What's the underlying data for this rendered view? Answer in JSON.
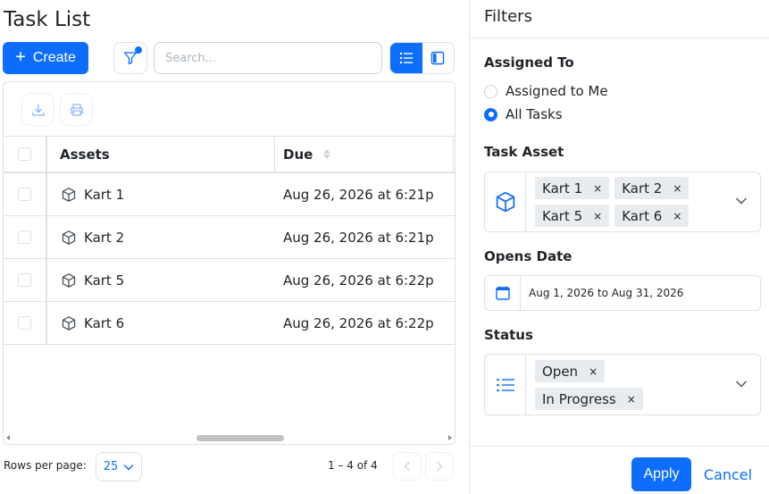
{
  "page": {
    "title": "Task List"
  },
  "toolbar": {
    "create_label": "Create",
    "search_placeholder": "Search..."
  },
  "table": {
    "columns": [
      "Assets",
      "Due"
    ],
    "rows": [
      {
        "asset": "Kart 1",
        "due": "Aug 26, 2026 at 6:21p"
      },
      {
        "asset": "Kart 2",
        "due": "Aug 26, 2026 at 6:21p"
      },
      {
        "asset": "Kart 5",
        "due": "Aug 26, 2026 at 6:22p"
      },
      {
        "asset": "Kart 6",
        "due": "Aug 26, 2026 at 6:22p"
      }
    ]
  },
  "pagination": {
    "rows_per_page_label": "Rows per page:",
    "rows_per_page_value": "25",
    "range": "1 – 4 of 4"
  },
  "filters": {
    "title": "Filters",
    "assigned_to": {
      "label": "Assigned To",
      "options": [
        {
          "label": "Assigned to Me",
          "selected": false
        },
        {
          "label": "All Tasks",
          "selected": true
        }
      ]
    },
    "task_asset": {
      "label": "Task Asset",
      "chips": [
        "Kart 1",
        "Kart 2",
        "Kart 5",
        "Kart 6"
      ]
    },
    "opens_date": {
      "label": "Opens Date",
      "value": "Aug 1, 2026 to Aug 31, 2026"
    },
    "status": {
      "label": "Status",
      "chips": [
        "Open",
        "In Progress"
      ]
    },
    "apply_label": "Apply",
    "cancel_label": "Cancel",
    "chip_remove_symbol": "×"
  },
  "colors": {
    "accent": "#0d6efd",
    "border": "#dee2e6"
  }
}
